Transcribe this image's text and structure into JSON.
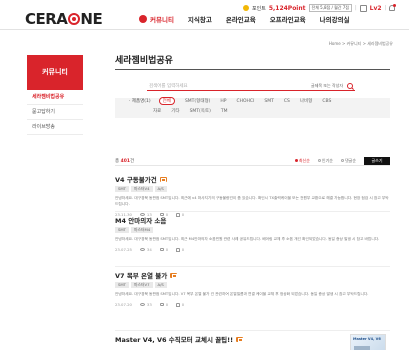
{
  "brand": {
    "logo_pre": "CERA",
    "logo_post": "NE",
    "accent": "#d9242b"
  },
  "util": {
    "point_label": "포인트",
    "point_value": "5,124Point",
    "point_box": "전체 5,8점 / 월간 7점",
    "level": "Lv2",
    "bell_icon": "bell-icon",
    "profile_icon": "user-icon"
  },
  "gnb": [
    {
      "label": "커뮤니티",
      "active": true
    },
    {
      "label": "지식창고"
    },
    {
      "label": "온라인교육"
    },
    {
      "label": "오프라인교육"
    },
    {
      "label": "나의강의실"
    }
  ],
  "breadcrumb": "Home > 커뮤니티 > 세라젬비법공유",
  "sidebar": {
    "title": "커뮤니티",
    "items": [
      {
        "label": "세라젬비법공유",
        "active": true
      },
      {
        "label": "묻고답하기"
      },
      {
        "label": "라이브방송"
      }
    ]
  },
  "main": {
    "title": "세라젬비법공유",
    "search_placeholder": "검색어를 입력하세요",
    "search_select": "글제목 또는 작성자",
    "cat_label": "· 제품명(1)",
    "cats_row1": [
      "전체",
      "SMT(형태형)",
      "HP",
      "CHOHCI",
      "SMT",
      "CS",
      "나비형",
      "CBS"
    ],
    "cats_row2": [
      "자료",
      "기타",
      "SMT(옥토)",
      "TM"
    ],
    "count_prefix": "총",
    "count_value": "401",
    "count_suffix": "건",
    "sort": [
      "최신순",
      "인기순",
      "댓글순"
    ],
    "write_btn": "글쓰기"
  },
  "posts": [
    {
      "title": "V4 구동불가건",
      "tags": [
        "SMT",
        "마스터V4",
        "A/S"
      ],
      "body": "안녕하세요. 대구경북 동판점 SMT입니다. 최근에 v4 마사지기의 구동불량건이 좀 있습니다. 확인시 TX출력케이블 또는 전원부 교환으로 해결 가능합니다. 현장 점검 시 참고 부탁드립니다.",
      "date": "23.11.30",
      "views": "13",
      "comments": "0",
      "likes": "0"
    },
    {
      "title": "M4 안마의자 소음",
      "tags": [
        "SMT",
        "마스터M4"
      ],
      "body": "안녕하세요. 대구경북 동판점 SMT입니다. 최근 M4안마의자 소음민원 관련 사례 공유드립니다. 베어링 교체 후 소음 개선 확인되었습니다. 동일 증상 발생 시 참고 바랍니다.",
      "date": "23.07.25",
      "views": "34",
      "comments": "0",
      "likes": "0"
    },
    {
      "title": "V7 목부 온열 불가",
      "tags": [
        "SMT",
        "마스터V7",
        "A/S"
      ],
      "body": "안녕하세요. 대구경북 동판점 SMT입니다. V7 목부 온열 불가 건 관련하여 온열필름과 연결 케이블 교체 후 정상화 되었습니다. 동일 증상 발생 시 참고 부탁드립니다.",
      "date": "23.07.20",
      "views": "33",
      "comments": "0",
      "likes": "0"
    },
    {
      "title": "Master V4, V6 수직모터 교체시 꿀팁!!",
      "tags": [],
      "body": "",
      "date": "",
      "views": "",
      "comments": "",
      "likes": "",
      "thumb_label": "Master V4, V6"
    }
  ]
}
